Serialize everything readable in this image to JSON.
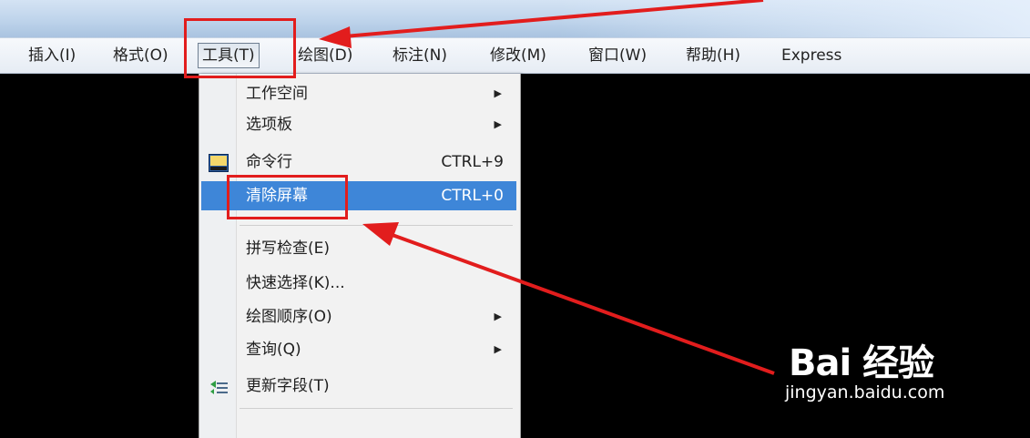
{
  "menubar": {
    "items": [
      {
        "label": "插入(I)"
      },
      {
        "label": "格式(O)"
      },
      {
        "label": "工具(T)"
      },
      {
        "label": "绘图(D)"
      },
      {
        "label": "标注(N)"
      },
      {
        "label": "修改(M)"
      },
      {
        "label": "窗口(W)"
      },
      {
        "label": "帮助(H)"
      },
      {
        "label": "Express"
      }
    ]
  },
  "tools_menu": {
    "items": [
      {
        "label": "工作空间",
        "submenu": true
      },
      {
        "label": "选项板",
        "submenu": true
      },
      {
        "label": "命令行",
        "shortcut": "CTRL+9",
        "icon": "command-line-icon"
      },
      {
        "label": "清除屏幕",
        "shortcut": "CTRL+0",
        "highlighted": true
      },
      {
        "label": "拼写检查(E)"
      },
      {
        "label": "快速选择(K)..."
      },
      {
        "label": "绘图顺序(O)",
        "submenu": true
      },
      {
        "label": "查询(Q)",
        "submenu": true
      },
      {
        "label": "更新字段(T)",
        "icon": "update-field-icon"
      }
    ],
    "submenu_arrow": "▶"
  },
  "watermark": {
    "logo": "Bai 经验",
    "url": "jingyan.baidu.com"
  },
  "colors": {
    "annotation_red": "#e21d1d",
    "highlight_blue": "#3e86d8"
  }
}
